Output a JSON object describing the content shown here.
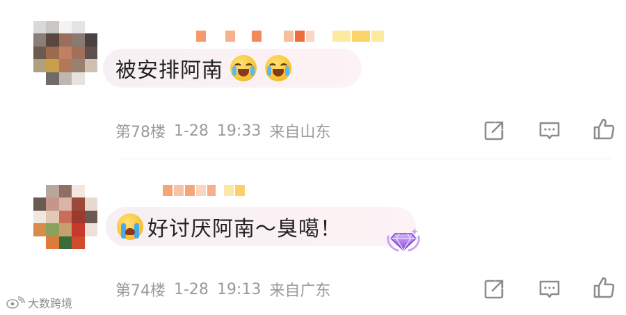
{
  "comments": [
    {
      "text": "被安排阿南",
      "floor": "第78楼",
      "date": "1-28",
      "time": "19:33",
      "location": "来自山东",
      "emoji_after": [
        "laugh-cry-emoji",
        "laugh-cry-emoji"
      ]
    },
    {
      "text": "好讨厌阿南～臭噶！",
      "floor": "第74楼",
      "date": "1-28",
      "time": "19:13",
      "location": "来自广东",
      "emoji_before": "loudly-crying-emoji",
      "badge": "purple-gem-badge"
    }
  ],
  "actions": [
    "share-icon",
    "comment-icon",
    "like-icon"
  ],
  "watermark": {
    "text": "大数跨境",
    "icon": "weibo-logo-icon"
  },
  "colors": {
    "bubble": "#f7f0f3",
    "meta_text": "#9a9a9a",
    "body_text": "#222222",
    "badge": "#a974e8"
  }
}
